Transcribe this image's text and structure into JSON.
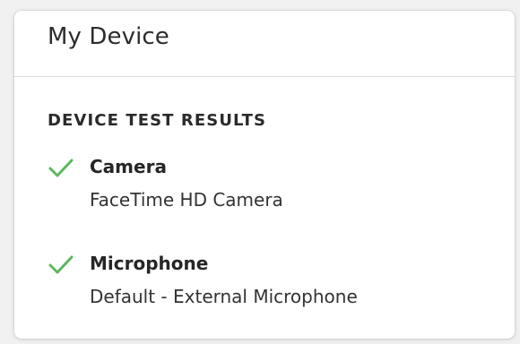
{
  "panel": {
    "title": "My Device"
  },
  "test_results": {
    "heading": "DEVICE TEST RESULTS",
    "items": [
      {
        "name": "Camera",
        "detail": "FaceTime HD Camera",
        "status_icon": "check-icon"
      },
      {
        "name": "Microphone",
        "detail": "Default - External Microphone",
        "status_icon": "check-icon"
      }
    ]
  },
  "colors": {
    "success": "#5cb85c",
    "card_background": "#ffffff",
    "page_background": "#f1f1f1",
    "divider": "#dcdcdc"
  }
}
